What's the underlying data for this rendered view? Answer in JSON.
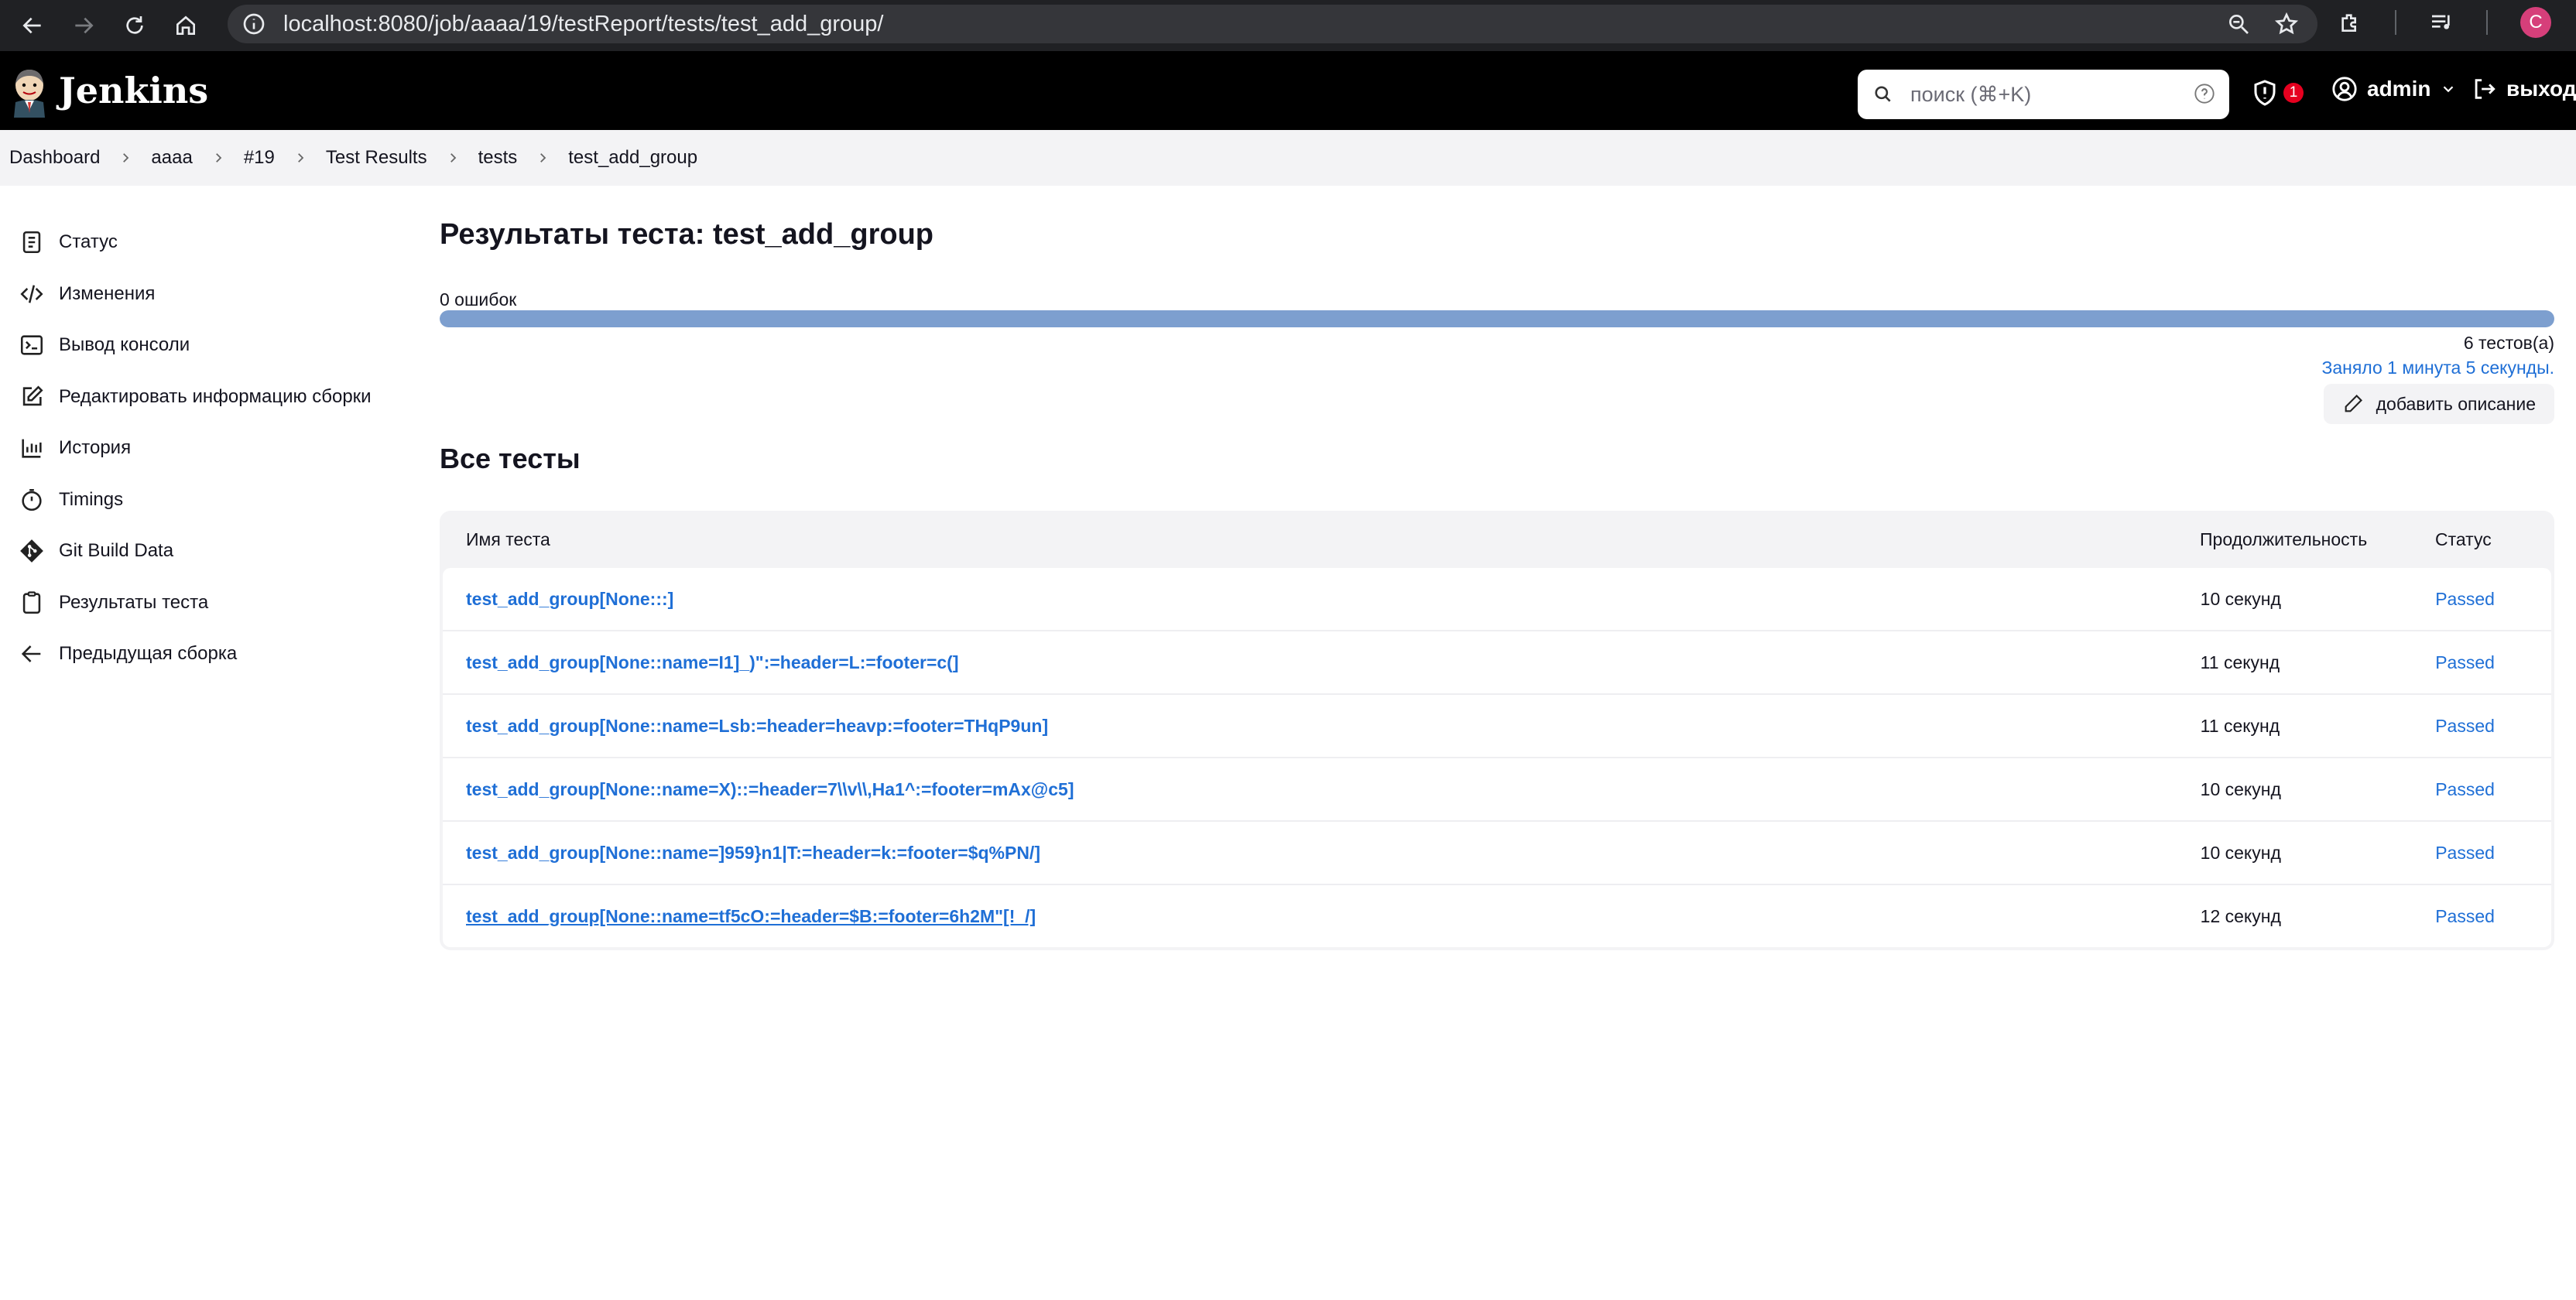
{
  "browser": {
    "url": "localhost:8080/job/aaaa/19/testReport/tests/test_add_group/",
    "profile_initial": "C"
  },
  "header": {
    "brand": "Jenkins",
    "search_placeholder": "поиск (⌘+K)",
    "security_count": "1",
    "user": "admin",
    "logout": "выход"
  },
  "breadcrumbs": [
    "Dashboard",
    "aaaa",
    "#19",
    "Test Results",
    "tests",
    "test_add_group"
  ],
  "sidebar": {
    "items": [
      {
        "label": "Статус",
        "icon": "status-icon"
      },
      {
        "label": "Изменения",
        "icon": "code-icon"
      },
      {
        "label": "Вывод консоли",
        "icon": "terminal-icon"
      },
      {
        "label": "Редактировать информацию сборки",
        "icon": "edit-icon"
      },
      {
        "label": "История",
        "icon": "history-chart-icon"
      },
      {
        "label": "Timings",
        "icon": "stopwatch-icon"
      },
      {
        "label": "Git Build Data",
        "icon": "git-icon"
      },
      {
        "label": "Результаты теста",
        "icon": "clipboard-icon"
      },
      {
        "label": "Предыдущая сборка",
        "icon": "arrow-left-icon"
      }
    ]
  },
  "main": {
    "title": "Результаты теста: test_add_group",
    "failures": "0 ошибок",
    "pass_fraction": 1.0,
    "tests_count": "6 тестов(а)",
    "took": "Заняло 1 минута 5 секунды.",
    "add_description": "добавить описание",
    "section_title": "Все тесты",
    "table": {
      "headers": {
        "name": "Имя теста",
        "duration": "Продолжительность",
        "status": "Статус"
      },
      "rows": [
        {
          "name": "test_add_group[None:::]",
          "duration": "10 секунд",
          "status": "Passed"
        },
        {
          "name": "test_add_group[None::name=I1]_)\":=header=L:=footer=c(]",
          "duration": "11 секунд",
          "status": "Passed"
        },
        {
          "name": "test_add_group[None::name=Lsb:=header=heavp:=footer=THqP9un]",
          "duration": "11 секунд",
          "status": "Passed"
        },
        {
          "name": "test_add_group[None::name=X)::=header=7\\\\v\\\\,Ha1^:=footer=mAx@c5]",
          "duration": "10 секунд",
          "status": "Passed"
        },
        {
          "name": "test_add_group[None::name=]959}n1|T:=header=k:=footer=$q%PN/]",
          "duration": "10 секунд",
          "status": "Passed"
        },
        {
          "name": "test_add_group[None::name=tf5cO:=header=$B:=footer=6h2M\"[!_/]",
          "duration": "12 секунд",
          "status": "Passed"
        }
      ]
    }
  },
  "colors": {
    "header_bg": "#000000",
    "link": "#1f6fd6",
    "progress_fill": "#7d9fcf",
    "badge": "#e6001f"
  }
}
